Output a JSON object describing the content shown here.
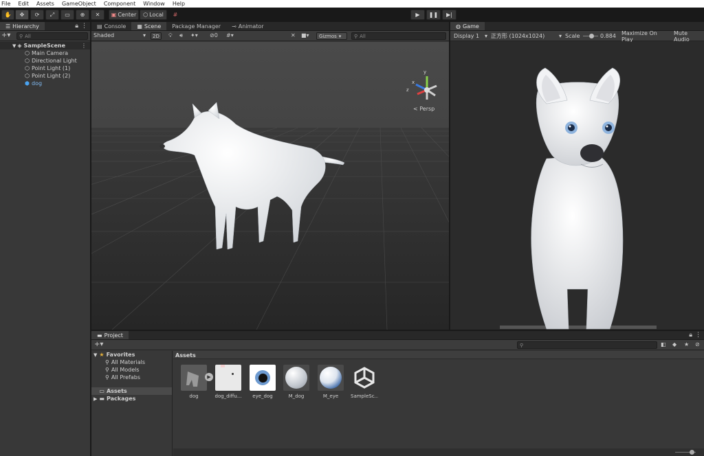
{
  "menu": [
    "File",
    "Edit",
    "Assets",
    "GameObject",
    "Component",
    "Window",
    "Help"
  ],
  "toolbar": {
    "center_label": "Center",
    "local_label": "Local"
  },
  "hierarchy": {
    "tab": "Hierarchy",
    "search_placeholder": "All",
    "scene_name": "SampleScene",
    "items": [
      {
        "label": "Main Camera",
        "icon": "gameobject-icon"
      },
      {
        "label": "Directional Light",
        "icon": "gameobject-icon"
      },
      {
        "label": "Point Light (1)",
        "icon": "gameobject-icon"
      },
      {
        "label": "Point Light (2)",
        "icon": "gameobject-icon"
      },
      {
        "label": "dog",
        "icon": "prefab-icon",
        "color": "#7fb8ef"
      }
    ]
  },
  "scene": {
    "tabs": [
      "Console",
      "Scene",
      "Package Manager",
      "Animator"
    ],
    "shading_mode": "Shaded",
    "mode_2d": "2D",
    "hidden_count": "0",
    "gizmos_label": "Gizmos",
    "search_placeholder": "All",
    "persp_label": "< Persp",
    "axis_labels": {
      "x": "x",
      "y": "y",
      "z": "z"
    }
  },
  "game": {
    "tab": "Game",
    "display": "Display 1",
    "resolution": "正方形 (1024x1024)",
    "scale_label": "Scale",
    "scale_value": 0.884,
    "scale_display": "0.884",
    "maximize_label": "Maximize On Play",
    "mute_label": "Mute Audio"
  },
  "project": {
    "tab": "Project",
    "favorites_label": "Favorites",
    "favorites": [
      "All Materials",
      "All Models",
      "All Prefabs"
    ],
    "folders": [
      "Assets",
      "Packages"
    ],
    "breadcrumb": "Assets",
    "assets": [
      {
        "label": "dog",
        "kind": "model"
      },
      {
        "label": "dog_diffu...",
        "kind": "texture"
      },
      {
        "label": "eye_dog",
        "kind": "eye-texture"
      },
      {
        "label": "M_dog",
        "kind": "material"
      },
      {
        "label": "M_eye",
        "kind": "material-eye"
      },
      {
        "label": "SampleSc...",
        "kind": "unity-scene"
      }
    ]
  },
  "colors": {
    "panel": "#383838",
    "dark": "#191919",
    "tab_bar": "#282828",
    "accent": "#2c5d87",
    "star": "#e8b33b"
  }
}
